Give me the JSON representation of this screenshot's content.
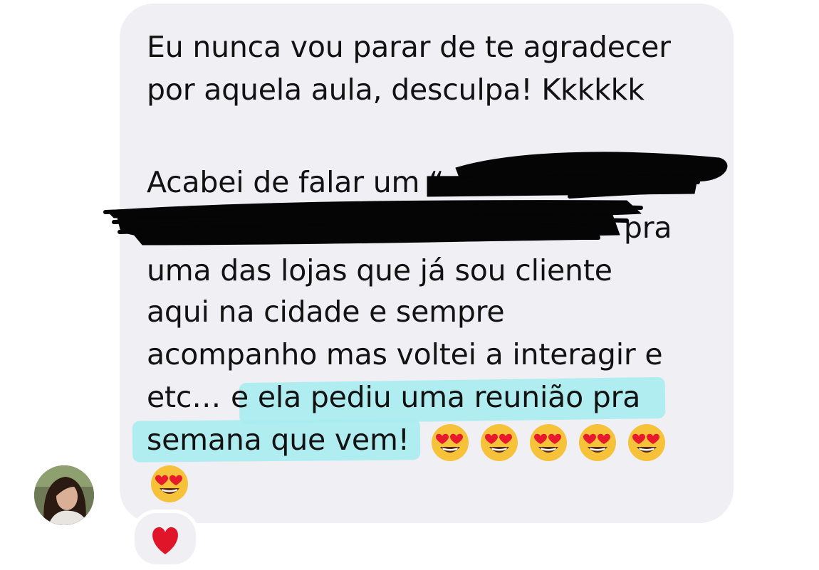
{
  "message": {
    "lines": [
      "Eu nunca vou parar de te agradecer",
      "por aquela aula, desculpa! Kkkkkk",
      "Acabei de falar um “",
      "” pra",
      "uma das lojas que já sou cliente",
      "aqui na cidade e sempre",
      "acompanho mas voltei a interagir e",
      "etc… ",
      " e ela pediu uma reunião pra",
      "semana que vem!"
    ],
    "emojis": [
      "heart-eyes",
      "heart-eyes",
      "heart-eyes",
      "heart-eyes",
      "heart-eyes",
      "heart-eyes"
    ]
  },
  "reaction": {
    "icon": "red-heart",
    "color": "#e0152a"
  },
  "colors": {
    "bubble": "#efeff4",
    "highlight": "#a9ecf0",
    "text": "#121212"
  }
}
